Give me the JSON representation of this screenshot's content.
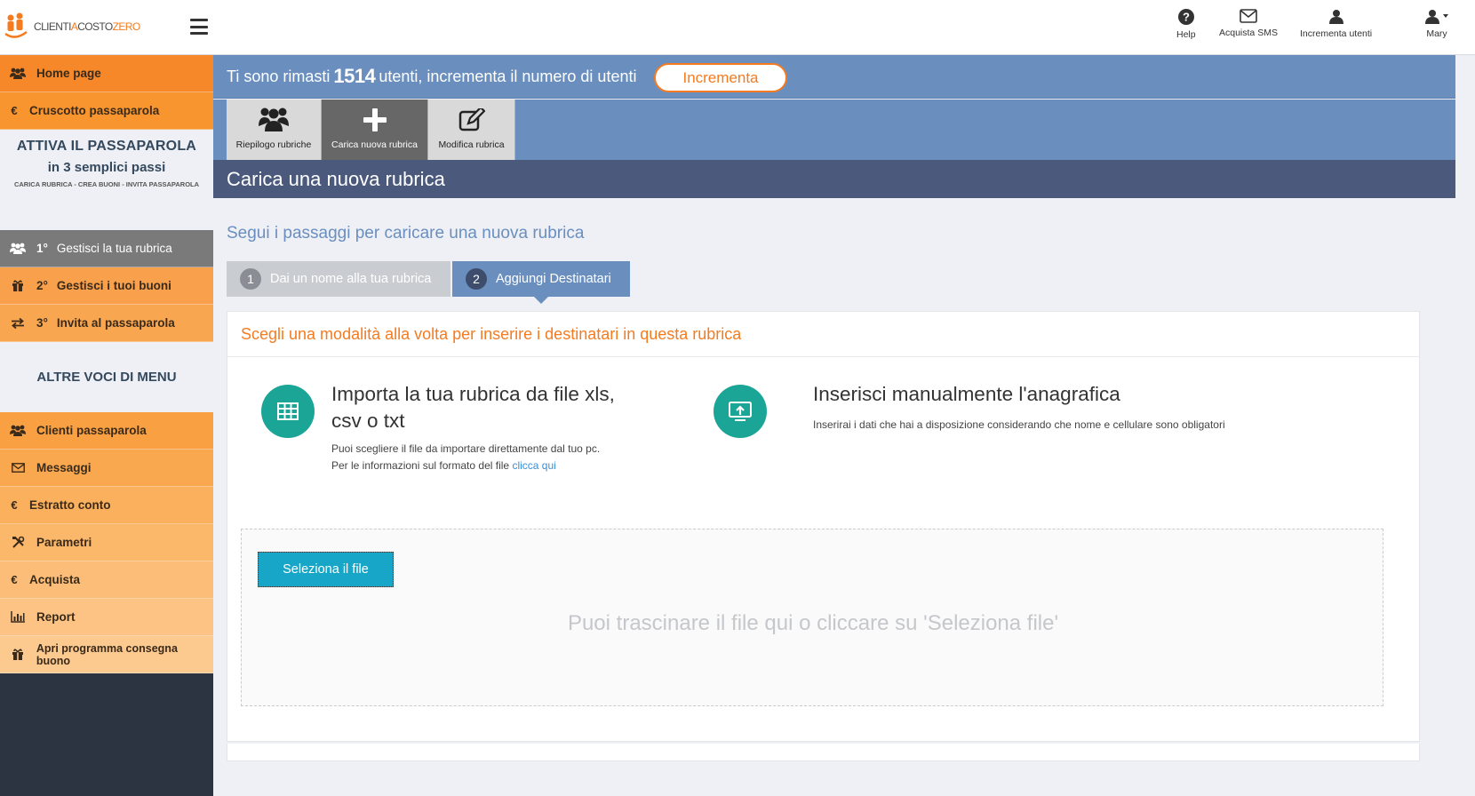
{
  "header": {
    "logo": {
      "text_a": "CLIENTI",
      "text_b": "A",
      "text_c": "COSTO",
      "text_d": "ZERO"
    },
    "nav": [
      {
        "label": "Help",
        "icon": "question-circle-icon"
      },
      {
        "label": "Acquista SMS",
        "icon": "envelope-icon"
      },
      {
        "label": "Incrementa utenti",
        "icon": "user-icon"
      },
      {
        "label": "Mary",
        "icon": "user-dropdown-icon"
      }
    ]
  },
  "sidebar": {
    "top_items": [
      {
        "label": "Home page",
        "icon": "users-icon",
        "color": "#f7882a"
      },
      {
        "label": "Cruscotto passaparola",
        "icon": "euro-icon",
        "color": "#f8952f"
      }
    ],
    "attiva": {
      "title": "ATTIVA IL PASSAPAROLA",
      "subtitle": "in 3 semplici passi",
      "steps_line": "CARICA RUBRICA - CREA BUONI - INVITA PASSAPAROLA"
    },
    "steps": [
      {
        "num": "1°",
        "label": "Gestisci la tua rubrica",
        "icon": "users-icon",
        "color": "#7a7a7a",
        "text_color": "#ffffff"
      },
      {
        "num": "2°",
        "label": "Gestisci i tuoi buoni",
        "icon": "gift-icon",
        "color": "#f9a04c",
        "text_color": "#3a2a1a"
      },
      {
        "num": "3°",
        "label": "Invita al passaparola",
        "icon": "exchange-icon",
        "color": "#f9a650",
        "text_color": "#3a2a1a"
      }
    ],
    "altre_heading": "ALTRE VOCI DI MENU",
    "menu": [
      {
        "label": "Clienti passaparola",
        "icon": "users-icon",
        "color": "#f9a042"
      },
      {
        "label": "Messaggi",
        "icon": "envelope-icon",
        "color": "#f9a84f"
      },
      {
        "label": "Estratto conto",
        "icon": "euro-icon",
        "color": "#fab05c"
      },
      {
        "label": "Parametri",
        "icon": "wrench-icon",
        "color": "#fbb76a"
      },
      {
        "label": "Acquista",
        "icon": "euro-icon",
        "color": "#fbbd77"
      },
      {
        "label": "Report",
        "icon": "bar-chart-icon",
        "color": "#fcc384"
      },
      {
        "label": "Apri programma consegna buono",
        "icon": "gift-icon",
        "color": "#fcc98f"
      }
    ]
  },
  "banner": {
    "text_before": "Ti sono rimasti",
    "count": "1514",
    "text_after": "utenti, incrementa il numero di utenti",
    "button": "Incrementa"
  },
  "tabs": [
    {
      "label": "Riepilogo rubriche",
      "icon": "users-icon"
    },
    {
      "label": "Carica nuova rubrica",
      "icon": "plus-icon"
    },
    {
      "label": "Modifica rubrica",
      "icon": "edit-icon"
    }
  ],
  "page_title": "Carica una nuova rubrica",
  "subtitle": "Segui i passaggi per caricare una nuova rubrica",
  "wizard": [
    {
      "num": "1",
      "label": "Dai un nome alla tua rubrica"
    },
    {
      "num": "2",
      "label": "Aggiungi Destinatari"
    }
  ],
  "card": {
    "heading": "Scegli una modalità alla volta per inserire i destinatari in questa rubrica",
    "import": {
      "title_line1": "Importa la tua rubrica da file xls,",
      "title_line2": "csv o txt",
      "desc_line1": "Puoi scegliere il file da importare direttamente dal tuo pc.",
      "desc_line2": "Per le informazioni sul formato del file",
      "link": "clicca qui"
    },
    "manual": {
      "title": "Inserisci manualmente l'anagrafica",
      "desc": "Inserirai i dati che hai a disposizione considerando che nome e cellulare sono obligatori"
    },
    "select_button": "Seleziona il file",
    "drop_text": "Puoi trascinare il file qui o cliccare su 'Seleziona file'"
  },
  "colors": {
    "accent_orange": "#f47b20",
    "banner_blue": "#6a8fbf",
    "header_navy": "#4b5a7c",
    "teal": "#1aa596",
    "select_button": "#17a6c7"
  }
}
